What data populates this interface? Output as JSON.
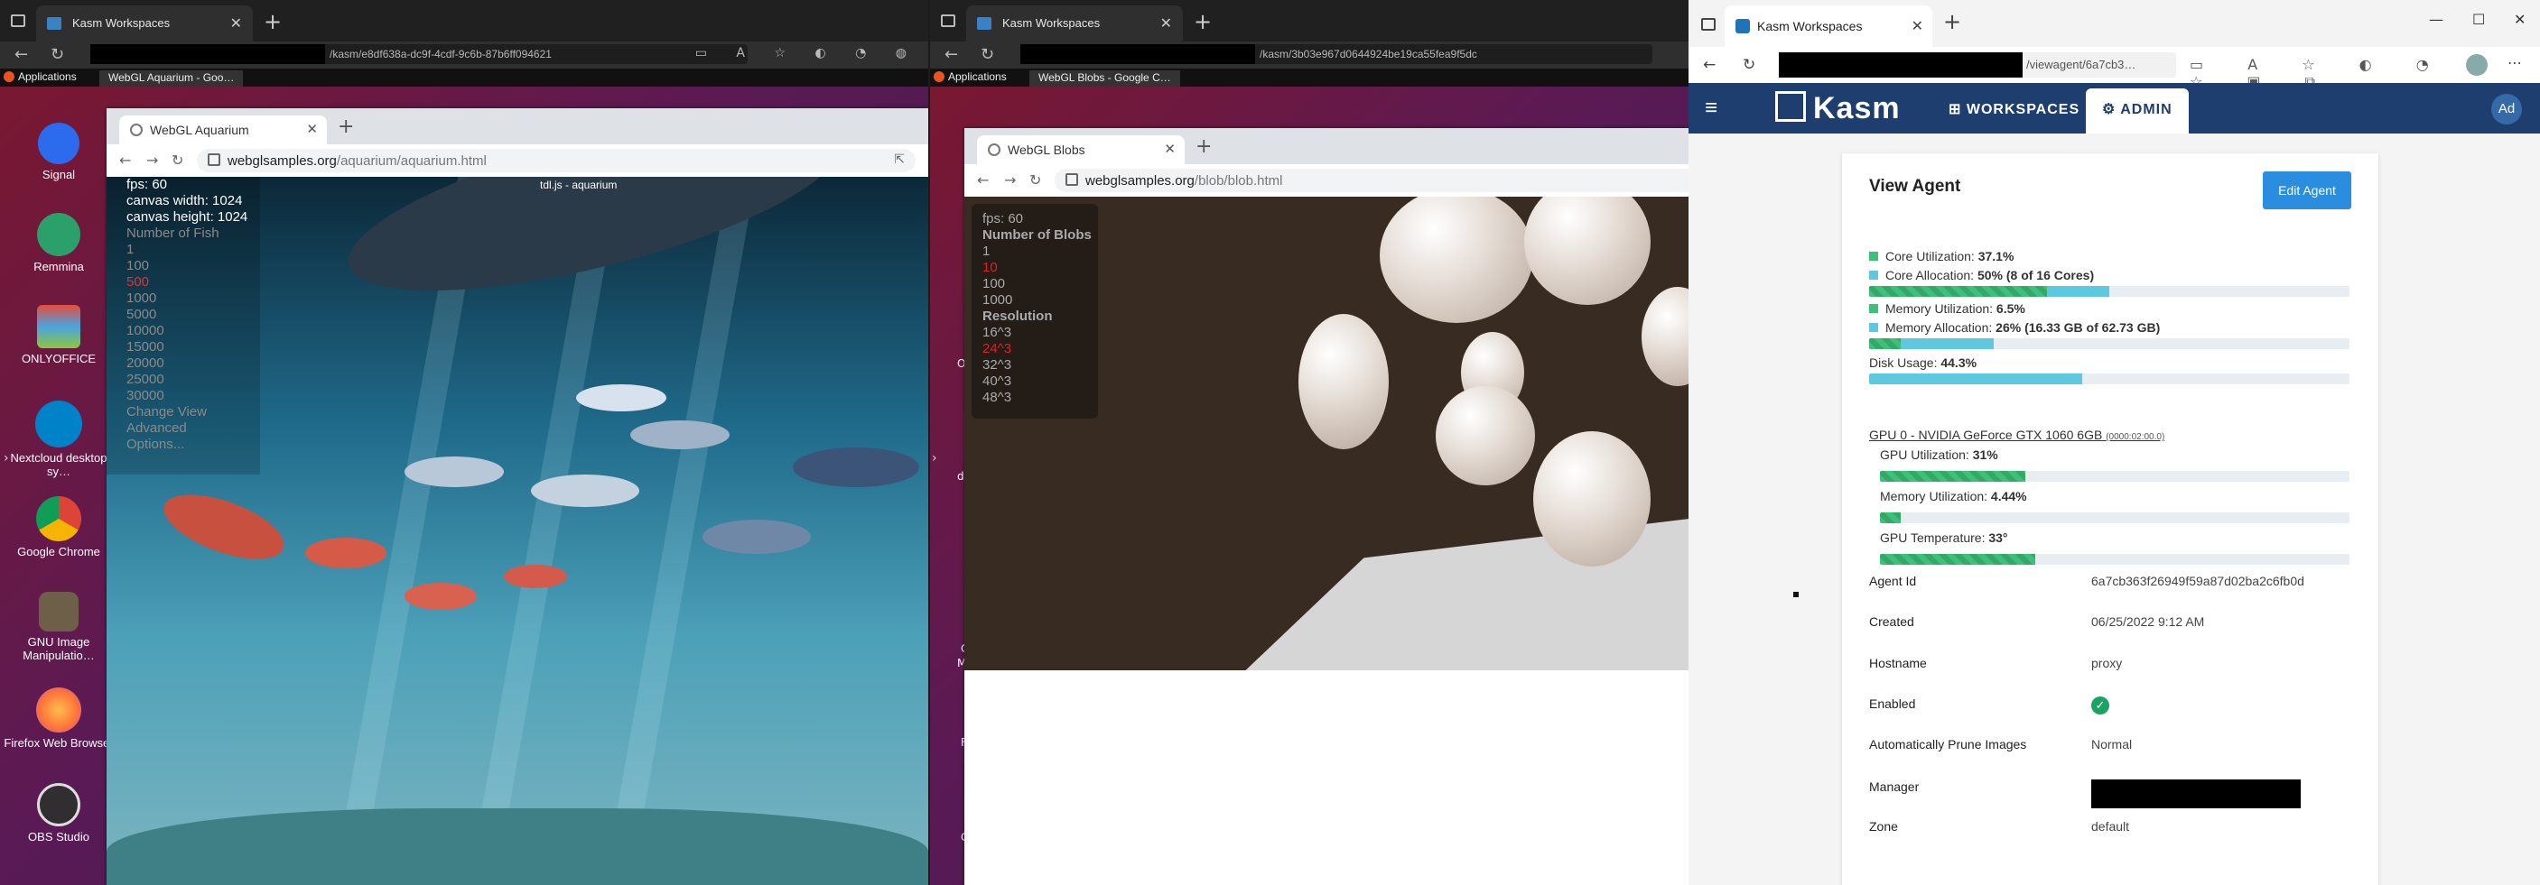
{
  "w1": {
    "outer_tab": "Kasm Workspaces",
    "url": "/kasm/e8df638a-dc9f-4cdf-9c6b-87b6ff094621",
    "taskbar_apps": "Applications",
    "taskbar_task": "WebGL Aquarium - Goo…",
    "dock": [
      "Signal",
      "Remmina",
      "ONLYOFFICE",
      "Nextcloud desktop sy…",
      "Google Chrome",
      "GNU Image Manipulatio…",
      "Firefox Web Browser",
      "OBS Studio"
    ],
    "inner_tab": "WebGL Aquarium",
    "inner_url_host": "webglsamples.org",
    "inner_url_path": "/aquarium/aquarium.html",
    "credit": "tdl.js - aquarium",
    "hud": [
      "fps: 60",
      "canvas width: 1024",
      "canvas height: 1024",
      "Number of Fish",
      "1",
      "100",
      "500",
      "1000",
      "5000",
      "10000",
      "15000",
      "20000",
      "25000",
      "30000",
      "Change View",
      "Advanced",
      "Options..."
    ]
  },
  "w2": {
    "outer_tab": "Kasm Workspaces",
    "url": "/kasm/3b03e967d0644924be19ca55fea9f5dc",
    "taskbar_apps": "Applications",
    "taskbar_task": "WebGL Blobs - Google C…",
    "inner_tab": "WebGL Blobs",
    "inner_url_host": "webglsamples.org",
    "inner_url_path": "/blob/blob.html",
    "hud": [
      "fps: 60",
      "Number of Blobs",
      "1",
      "10",
      "100",
      "1000",
      "Resolution",
      "16^3",
      "24^3",
      "32^3",
      "40^3",
      "48^3"
    ],
    "left_fragments": [
      "O",
      "de",
      "C",
      "Ma",
      "F",
      "G"
    ]
  },
  "w3": {
    "tab": "Kasm Workspaces",
    "url": "/viewagent/6a7cb3…",
    "logo": "Kasm",
    "nav_workspaces": "WORKSPACES",
    "nav_admin": "ADMIN",
    "avatar": "Ad",
    "title": "View Agent",
    "edit_button": "Edit Agent",
    "metrics": {
      "core_util_label": "Core Utilization:",
      "core_util_value": "37.1%",
      "core_util": 0.371,
      "core_alloc_label": "Core Allocation:",
      "core_alloc_value": "50% (8 of 16 Cores)",
      "core_alloc": 0.5,
      "mem_util_label": "Memory Utilization:",
      "mem_util_value": "6.5%",
      "mem_util": 0.065,
      "mem_alloc_label": "Memory Allocation:",
      "mem_alloc_value": "26% (16.33 GB of 62.73 GB)",
      "mem_alloc": 0.26,
      "disk_label": "Disk Usage:",
      "disk_value": "44.3%",
      "disk": 0.443
    },
    "gpu": {
      "name": "GPU 0 - NVIDIA GeForce GTX 1060 6GB",
      "bus": "(0000:02:00.0)",
      "util_label": "GPU Utilization:",
      "util_value": "31%",
      "util": 0.31,
      "mem_label": "Memory Utilization:",
      "mem_value": "4.44%",
      "mem": 0.0444,
      "temp_label": "GPU Temperature:",
      "temp_value": "33°",
      "temp": 0.33
    },
    "details": [
      {
        "k": "Agent Id",
        "v": "6a7cb363f26949f59a87d02ba2c6fb0d"
      },
      {
        "k": "Created",
        "v": "06/25/2022 9:12 AM"
      },
      {
        "k": "Hostname",
        "v": "proxy"
      },
      {
        "k": "Enabled",
        "v": "✓"
      },
      {
        "k": "Automatically Prune Images",
        "v": "Normal"
      },
      {
        "k": "Manager",
        "v": ""
      },
      {
        "k": "Zone",
        "v": "default"
      }
    ],
    "colors": {
      "nav": "#1d3e6e",
      "button": "#2a8de0",
      "bar_green": "#3fc07a",
      "bar_cyan": "#5ec8e0"
    }
  }
}
